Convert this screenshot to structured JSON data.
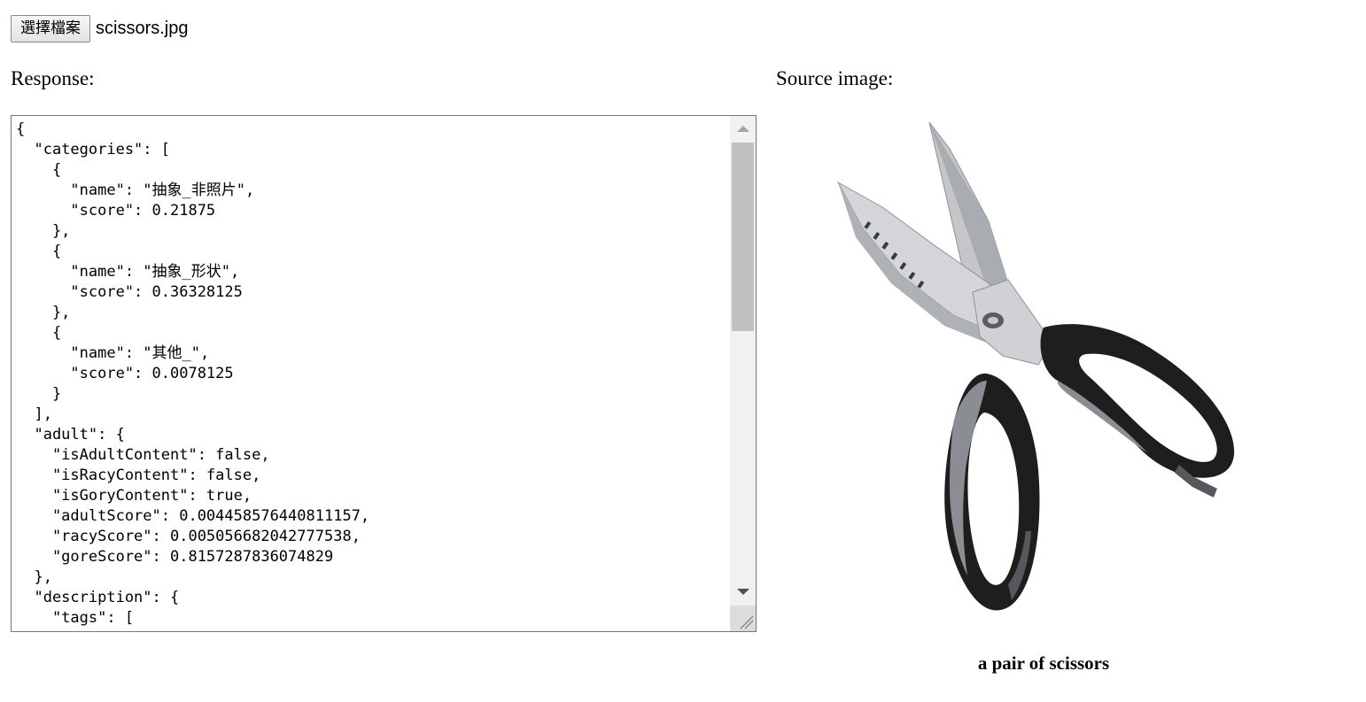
{
  "file_input": {
    "button_label": "選擇檔案",
    "file_name": "scissors.jpg"
  },
  "response_label": "Response:",
  "source_label": "Source image:",
  "response_text": "{\n  \"categories\": [\n    {\n      \"name\": \"抽象_非照片\",\n      \"score\": 0.21875\n    },\n    {\n      \"name\": \"抽象_形状\",\n      \"score\": 0.36328125\n    },\n    {\n      \"name\": \"其他_\",\n      \"score\": 0.0078125\n    }\n  ],\n  \"adult\": {\n    \"isAdultContent\": false,\n    \"isRacyContent\": false,\n    \"isGoryContent\": true,\n    \"adultScore\": 0.004458576440811157,\n    \"racyScore\": 0.005056682042777538,\n    \"goreScore\": 0.8157287836074829\n  },\n  \"description\": {\n    \"tags\": [",
  "caption": "a pair of scissors",
  "colors": {
    "handle_dark": "#1e1e1e",
    "handle_grey": "#8a8d92",
    "blade": "#c9cbce"
  }
}
